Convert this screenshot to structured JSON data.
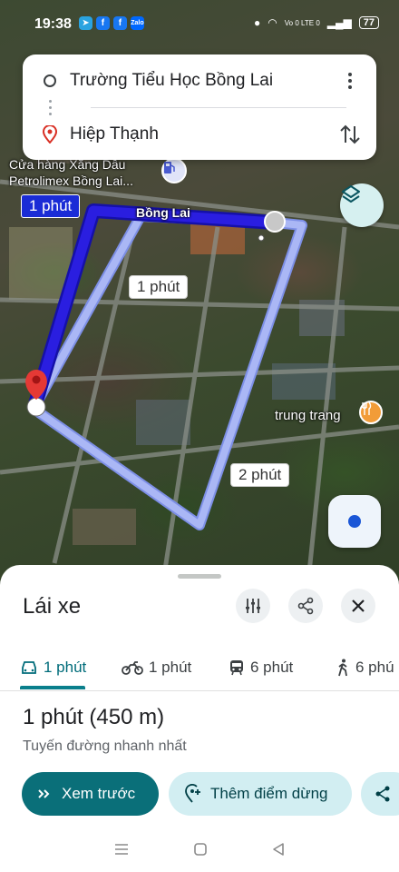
{
  "status_bar": {
    "time": "19:38",
    "network": "Vo 0 LTE 0",
    "battery": "77",
    "app_icons": [
      "telegram-icon",
      "facebook-icon",
      "facebook-icon",
      "zalo-icon"
    ]
  },
  "directions": {
    "origin": "Trường Tiểu Học Bồng Lai",
    "destination": "Hiệp Thạnh"
  },
  "map": {
    "poi_fuel_line1": "Cửa hàng Xăng Dầu",
    "poi_fuel_line2": "Petrolimex Bồng Lai...",
    "road_label": "Bồng Lai",
    "poi_food": "trung trang",
    "route_labels": {
      "primary": "1 phút",
      "alt1": "1 phút",
      "alt2": "2 phút"
    },
    "colors": {
      "route_primary": "#2a1ee0",
      "route_alt": "#aab7f5",
      "pin": "#e53935"
    }
  },
  "sheet": {
    "title": "Lái xe",
    "modes": [
      {
        "icon": "car-icon",
        "label": "1 phút",
        "active": true
      },
      {
        "icon": "motorbike-icon",
        "label": "1 phút",
        "active": false
      },
      {
        "icon": "transit-icon",
        "label": "6 phút",
        "active": false
      },
      {
        "icon": "walk-icon",
        "label": "6 phú",
        "active": false
      }
    ],
    "route_time": "1 phút (450 m)",
    "route_desc": "Tuyến đường nhanh nhất",
    "preview_label": "Xem trước",
    "add_stop_label": "Thêm điểm dừng"
  }
}
